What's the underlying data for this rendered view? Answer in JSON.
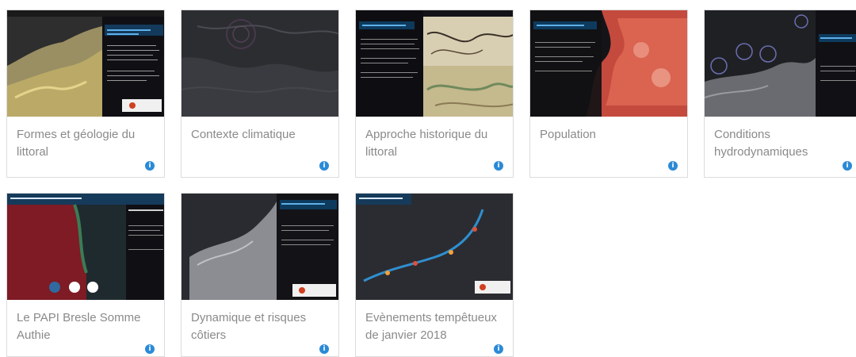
{
  "cards": [
    {
      "title": "Formes et géologie du littoral"
    },
    {
      "title": "Contexte climatique"
    },
    {
      "title": "Approche historique du littoral"
    },
    {
      "title": "Population"
    },
    {
      "title": "Conditions hydrodynamiques"
    },
    {
      "title": "Le PAPI Bresle Somme Authie"
    },
    {
      "title": "Dynamique et risques côtiers"
    },
    {
      "title": "Evènements tempêtueux de janvier 2018"
    }
  ],
  "info_glyph": "i",
  "colors": {
    "info": "#2b8ad6",
    "caption": "#8a8a8a",
    "card_border": "#dcdcdc"
  }
}
